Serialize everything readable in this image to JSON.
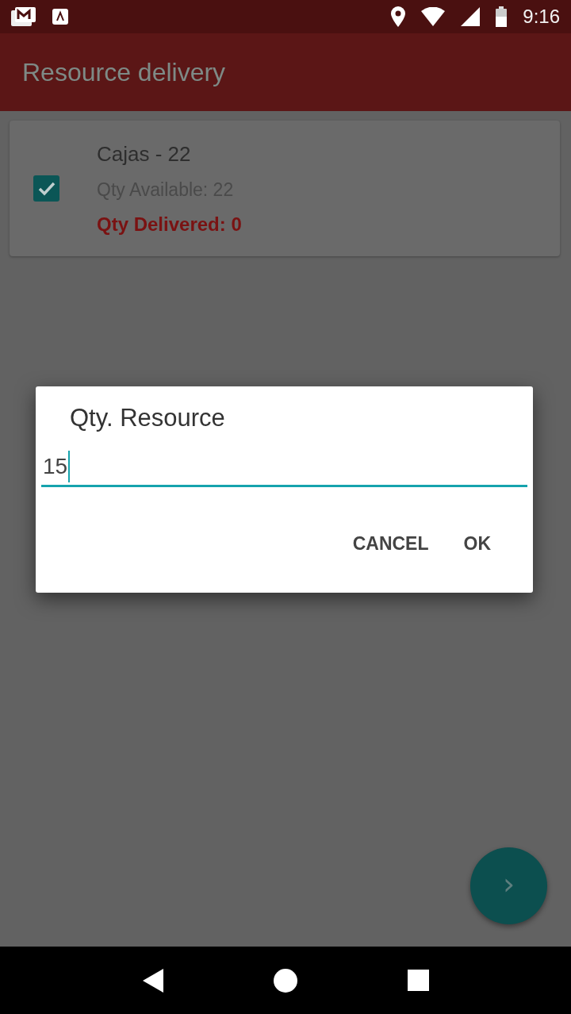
{
  "status_bar": {
    "time": "9:16"
  },
  "app_bar": {
    "title": "Resource delivery"
  },
  "items": [
    {
      "name": "Cajas - 22",
      "available": "Qty Available: 22",
      "delivered": "Qty Delivered: 0",
      "checked": true
    }
  ],
  "dialog": {
    "title": "Qty. Resource",
    "value": "15",
    "buttons": [
      "CANCEL",
      "OK"
    ]
  },
  "fab": {
    "icon": "›"
  }
}
